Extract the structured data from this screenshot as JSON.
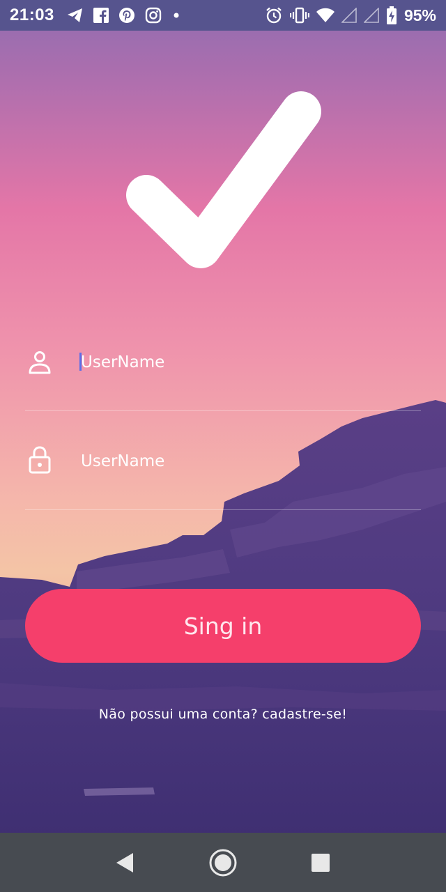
{
  "status_bar": {
    "time": "21:03",
    "left_icons": [
      "telegram-icon",
      "facebook-icon",
      "pinterest-icon",
      "instagram-icon",
      "dot-icon"
    ],
    "right_icons": [
      "alarm-icon",
      "vibrate-icon",
      "wifi-icon",
      "signal-icon",
      "signal-icon",
      "battery-charging-icon"
    ],
    "battery_percent": "95%"
  },
  "colors": {
    "status_bar_bg": "#56548e",
    "button_bg": "#f53f6b",
    "nav_bar_bg": "#474b51",
    "mountain_color": "#4f3a7e"
  },
  "logo": {
    "icon": "checkmark-icon"
  },
  "form": {
    "username": {
      "icon": "user-icon",
      "placeholder": "UserName",
      "value": ""
    },
    "password": {
      "icon": "lock-icon",
      "placeholder": "UserName",
      "value": ""
    },
    "submit_label": "Sing in",
    "signup_text": "Não possui uma conta? cadastre-se!"
  },
  "nav_bar": {
    "buttons": [
      "back-icon",
      "home-icon",
      "recents-icon"
    ]
  }
}
